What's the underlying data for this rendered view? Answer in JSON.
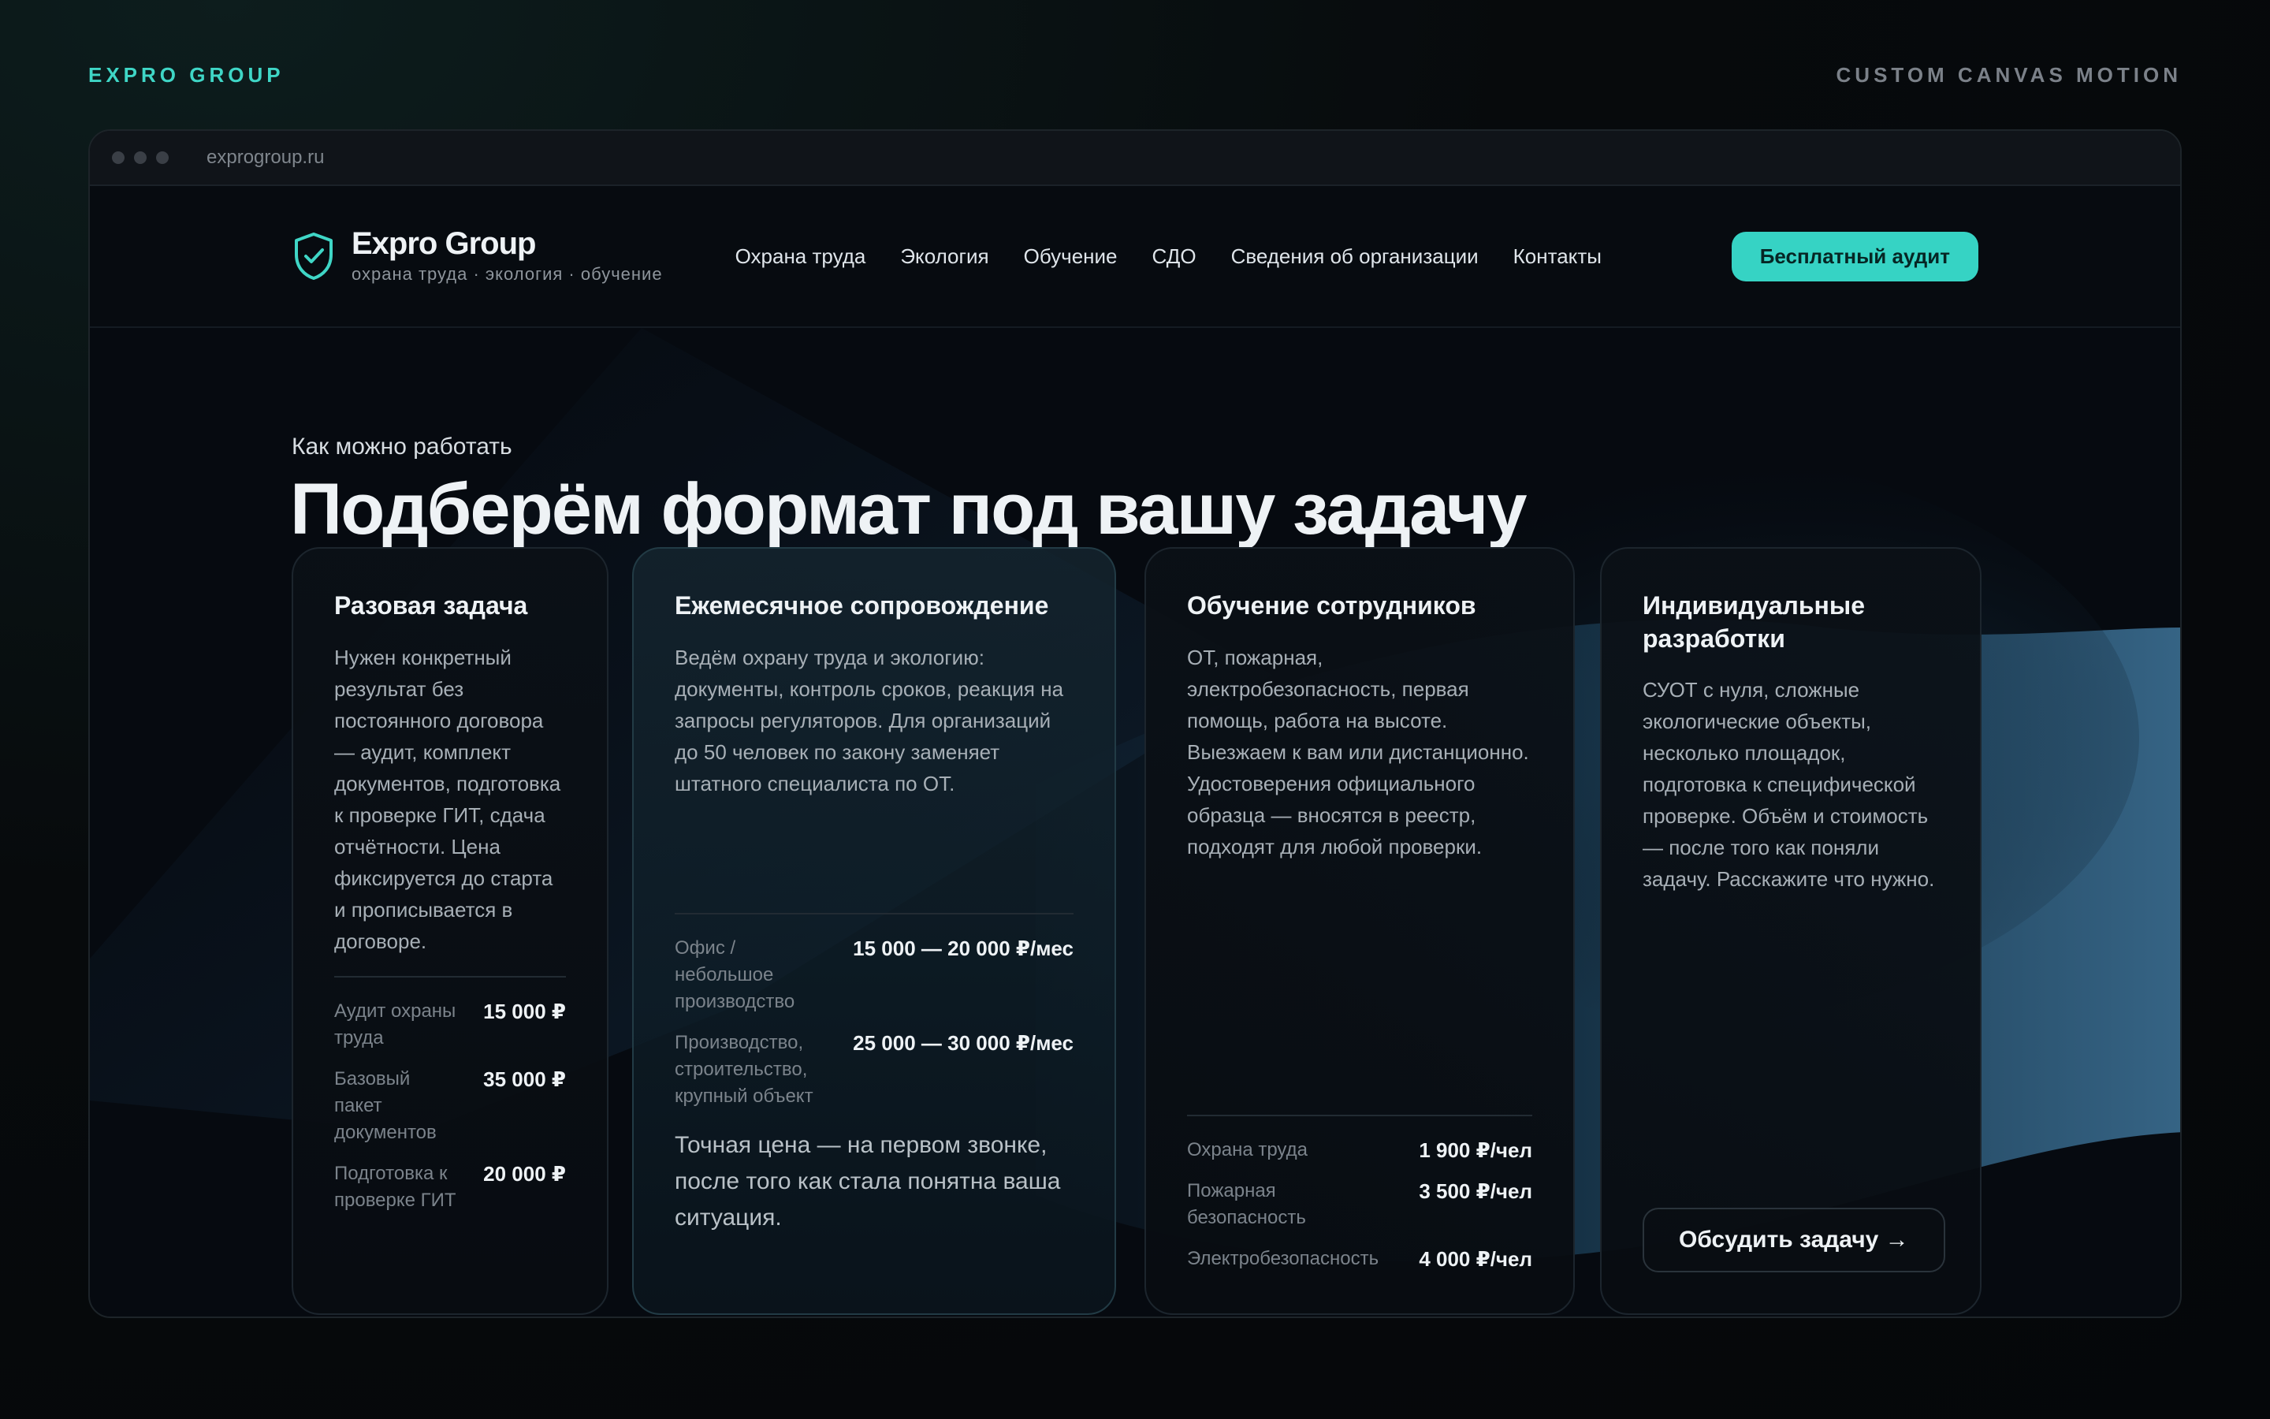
{
  "top": {
    "brand": "EXPRO GROUP",
    "right_label": "CUSTOM CANVAS MOTION"
  },
  "browser": {
    "url": "exprogroup.ru"
  },
  "nav": {
    "logo_name": "Expro Group",
    "logo_sub": "охрана труда · экология · обучение",
    "items": [
      "Охрана труда",
      "Экология",
      "Обучение",
      "СДО",
      "Сведения об организации",
      "Контакты"
    ],
    "cta": "Бесплатный аудит"
  },
  "hero": {
    "kicker": "Как можно работать",
    "title": "Подберём формат под вашу задачу"
  },
  "cards": [
    {
      "title": "Разовая задача",
      "body": "Нужен конкретный результат без постоянного договора — аудит, комплект документов, подготовка к проверке ГИТ, сдача отчётности. Цена фиксируется до старта и прописывается в договоре.",
      "prices": [
        {
          "label": "Аудит охраны труда",
          "value": "15 000 ₽"
        },
        {
          "label": "Базовый пакет документов",
          "value": "35 000 ₽"
        },
        {
          "label": "Подготовка к проверке ГИТ",
          "value": "20 000 ₽"
        }
      ]
    },
    {
      "title": "Ежемесячное сопровождение",
      "body": "Ведём охрану труда и экологию: документы, контроль сроков, реакция на запросы регуляторов. Для организаций до 50 человек по закону заменяет штатного специалиста по ОТ.",
      "prices": [
        {
          "label": "Офис / небольшое производство",
          "value": "15 000 — 20 000 ₽/мес"
        },
        {
          "label": "Производство, строительство, крупный объект",
          "value": "25 000 — 30 000 ₽/мес"
        }
      ],
      "note": "Точная цена — на первом звонке, после того как стала понятна ваша ситуация."
    },
    {
      "title": "Обучение сотрудников",
      "body": "ОТ, пожарная, электробезопасность, первая помощь, работа на высоте. Выезжаем к вам или дистанционно. Удостоверения официального образца — вносятся в реестр, подходят для любой проверки.",
      "prices": [
        {
          "label": "Охрана труда",
          "value": "1 900 ₽/чел"
        },
        {
          "label": "Пожарная безопасность",
          "value": "3 500 ₽/чел"
        },
        {
          "label": "Электробезопасность",
          "value": "4 000 ₽/чел"
        }
      ]
    },
    {
      "title": "Индивидуальные разработки",
      "body": "СУОТ с нуля, сложные экологические объекты, несколько площадок, подготовка к специфической проверке. Объём и стоимость — после того как поняли задачу. Расскажите что нужно.",
      "button": "Обсудить задачу →"
    }
  ],
  "colors": {
    "accent": "#36d3c4",
    "background": "#060a10",
    "brand_top": "#3fd6c6"
  }
}
